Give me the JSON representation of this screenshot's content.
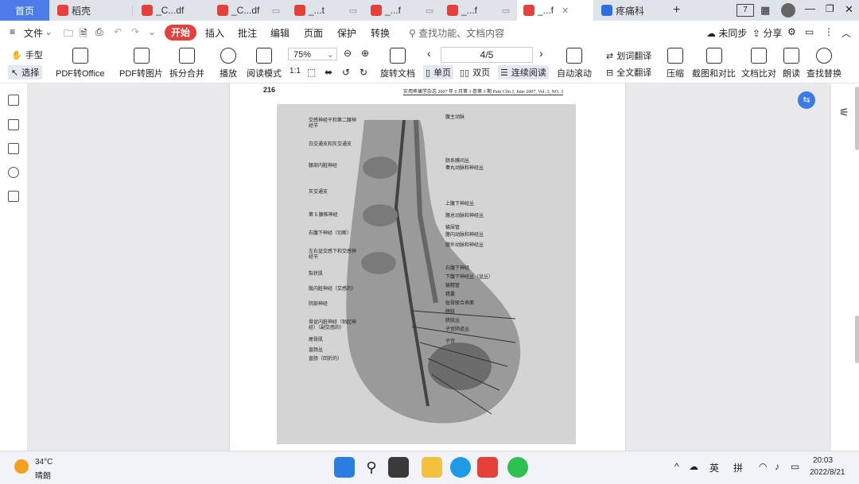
{
  "tabs": [
    {
      "label": "首页"
    },
    {
      "label": "稻壳"
    },
    {
      "label": "_C...df"
    },
    {
      "label": "_C...df"
    },
    {
      "label": "_...t"
    },
    {
      "label": "_...f"
    },
    {
      "label": "_...f"
    },
    {
      "label": "_...f"
    },
    {
      "label": "疼痛科"
    }
  ],
  "window": {
    "badge": "7"
  },
  "menu": {
    "file": "文件",
    "start": "开始",
    "items": [
      "插入",
      "批注",
      "编辑",
      "页面",
      "保护",
      "转换"
    ],
    "search": "查找功能、文档内容",
    "sync": "未同步",
    "share": "分享"
  },
  "toolbar": {
    "hand": "手型",
    "select": "选择",
    "pdf_office": "PDF转Office",
    "pdf_image": "PDF转图片",
    "split_merge": "拆分合并",
    "play": "播放",
    "read_mode": "阅读模式",
    "zoom": "75%",
    "page_indicator": "4/5",
    "rotate_doc": "旋转文档",
    "single": "单页",
    "double": "双页",
    "continuous": "连续阅读",
    "autoscroll": "自动滚动",
    "word_translate": "划词翻译",
    "full_translate": "全文翻译",
    "compress": "压缩",
    "screenshot": "截图和对比",
    "doc_compare": "文档比对",
    "read_aloud": "朗读",
    "find_replace": "查找替换"
  },
  "page": {
    "page_number": "216",
    "journal_header": "实用疼痛学杂志 2007 年 6 月第 3 卷第 3 期   Pain Clin J, June 2007, Vol. 3, NO. 3"
  },
  "figure_labels": {
    "left": [
      "交感神经干和第二腰神经节",
      "白交通支和灰交通支",
      "腰部内脏神经",
      "灰交通支",
      "第 5 腰椎神经",
      "右腹下神经（切断）",
      "左右盆交感下和交感神经节",
      "梨状肌",
      "骶内脏神经（交感的）",
      "阴部神经",
      "骨盆内脏神经（勃起神经）（副交感的）",
      "尾骨肌",
      "直肠丛",
      "直肠（回折的）"
    ],
    "right": [
      "腹主动脉",
      "肠系膜间丛",
      "睾丸动脉和神经丛",
      "上腹下神经丛",
      "髂总动脉和神经丛",
      "输尿管",
      "髂内动脉和神经丛",
      "髂外动脉和神经丛",
      "右腹下神经",
      "下腹下神经丛（盆丛）",
      "输精管",
      "精囊",
      "耻骨联合表面",
      "膀胱",
      "膀胱丛",
      "子宫阴道丛",
      "子宫"
    ]
  },
  "taskbar": {
    "temp": "34°C",
    "weather": "晴朗",
    "ime_lang": "英",
    "ime_mode": "拼",
    "time": "20:03",
    "date": "2022/8/21"
  }
}
